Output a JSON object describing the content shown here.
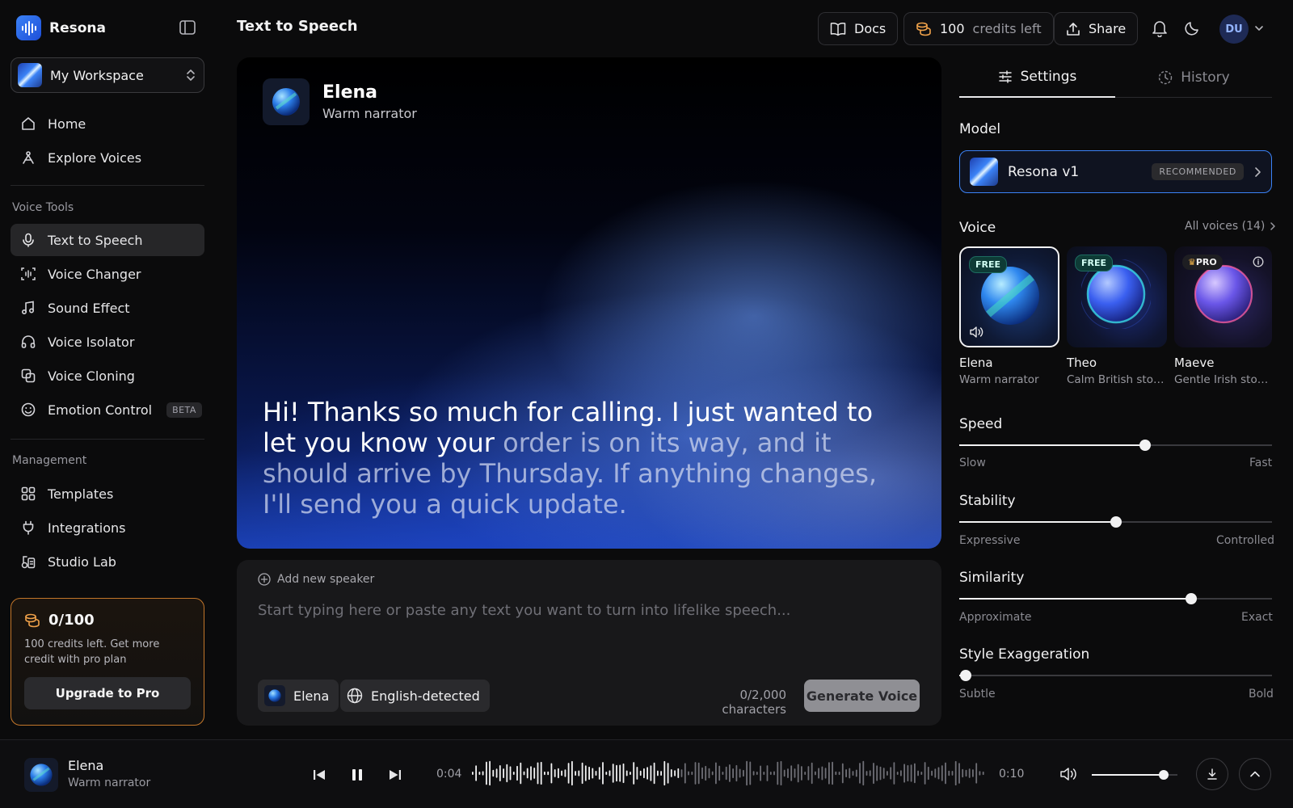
{
  "brand": {
    "name": "Resona"
  },
  "workspace": {
    "name": "My Workspace"
  },
  "nav": {
    "home": "Home",
    "explore": "Explore Voices",
    "voice_tools_label": "Voice Tools",
    "tts": "Text to Speech",
    "voice_changer": "Voice Changer",
    "sound_effect": "Sound Effect",
    "voice_isolator": "Voice Isolator",
    "voice_cloning": "Voice Cloning",
    "emotion_control": "Emotion Control",
    "beta": "BETA",
    "management_label": "Management",
    "templates": "Templates",
    "integrations": "Integrations",
    "studio_lab": "Studio Lab"
  },
  "credits_card": {
    "count": "0/100",
    "text": "100 credits left. Get more credit with pro plan",
    "upgrade": "Upgrade to Pro"
  },
  "header": {
    "title": "Text to Speech",
    "docs": "Docs",
    "credits_num": "100",
    "credits_label": "credits left",
    "share": "Share",
    "avatar": "DU"
  },
  "hero": {
    "voice_name": "Elena",
    "voice_desc": "Warm narrator",
    "text_highlight": "Hi! Thanks so much for calling. I just wanted to let you know your",
    "text_rest": " order is on its way, and it should arrive by Thursday. If anything changes, I'll send you a quick update."
  },
  "editor": {
    "add_speaker": "Add new speaker",
    "placeholder": "Start typing here or paste any text you want to turn into lifelike speech...",
    "voice_chip": "Elena",
    "language_chip": "English-detected",
    "char_count": "0/2,000 characters",
    "generate": "Generate Voice"
  },
  "panel": {
    "tab_settings": "Settings",
    "tab_history": "History",
    "model_label": "Model",
    "model_name": "Resona v1",
    "model_badge": "RECOMMENDED",
    "voice_label": "Voice",
    "all_voices": "All voices (14)",
    "voices": [
      {
        "name": "Elena",
        "desc": "Warm narrator",
        "badge": "FREE",
        "selected": true
      },
      {
        "name": "Theo",
        "desc": "Calm British storyteller",
        "badge": "FREE",
        "selected": false
      },
      {
        "name": "Maeve",
        "desc": "Gentle Irish storyteller",
        "badge": "PRO",
        "selected": false
      }
    ],
    "sliders": [
      {
        "label": "Speed",
        "min_label": "Slow",
        "max_label": "Fast",
        "value": 0.595
      },
      {
        "label": "Stability",
        "min_label": "Expressive",
        "max_label": "Controlled",
        "value": 0.5
      },
      {
        "label": "Similarity",
        "min_label": "Approximate",
        "max_label": "Exact",
        "value": 0.742
      },
      {
        "label": "Style Exaggeration",
        "min_label": "Subtle",
        "max_label": "Bold",
        "value": 0.02
      }
    ]
  },
  "player": {
    "name": "Elena",
    "desc": "Warm narrator",
    "current_time": "0:04",
    "total_time": "0:10",
    "progress": 0.4,
    "volume": 0.84
  },
  "colors": {
    "accent": "#3b82f6",
    "credits_border": "#c2762a",
    "free_badge": "#0e3b36"
  }
}
